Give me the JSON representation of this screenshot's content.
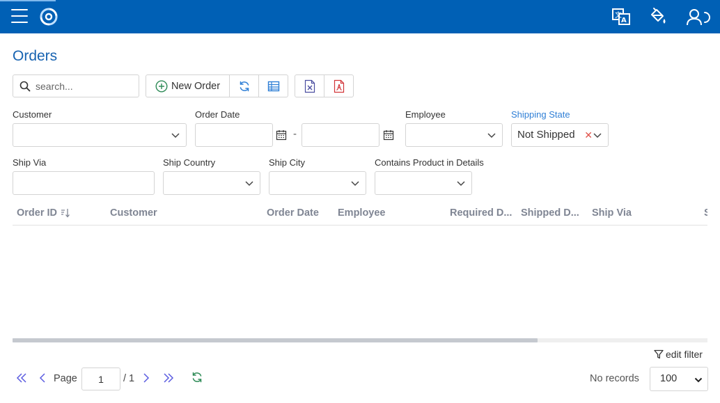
{
  "page": {
    "title": "Orders"
  },
  "toolbar": {
    "search_placeholder": "search...",
    "new_order_label": "New Order"
  },
  "filters": {
    "customer": {
      "label": "Customer",
      "value": ""
    },
    "order_date": {
      "label": "Order Date",
      "from": "",
      "to": "",
      "separator": "-"
    },
    "employee": {
      "label": "Employee",
      "value": ""
    },
    "shipping_state": {
      "label": "Shipping State",
      "value": "Not Shipped"
    },
    "ship_via": {
      "label": "Ship Via",
      "value": ""
    },
    "ship_country": {
      "label": "Ship Country",
      "value": ""
    },
    "ship_city": {
      "label": "Ship City",
      "value": ""
    },
    "contains_product": {
      "label": "Contains Product in Details",
      "value": ""
    }
  },
  "grid": {
    "columns": [
      "Order ID",
      "Customer",
      "Order Date",
      "Employee",
      "Required D...",
      "Shipped D...",
      "Ship Via",
      "S"
    ],
    "rows": []
  },
  "footer": {
    "edit_filter_label": "edit filter",
    "page_label": "Page",
    "current_page": "1",
    "total_pages_label": "/ 1",
    "status": "No records",
    "page_size": "100"
  },
  "colors": {
    "header_bg": "#0060b5",
    "title": "#1763b1",
    "accent_blue": "#2f7fd6",
    "green": "#2e8b57",
    "excel": "#4a4ea0",
    "pdf": "#d13438",
    "pager": "#5b5ce0"
  },
  "icons": {
    "header": [
      "menu-icon",
      "logo-icon",
      "translate-icon",
      "theme-icon",
      "user-icon"
    ],
    "toolbar": [
      "search-icon",
      "add-icon",
      "refresh-icon",
      "column-picker-icon",
      "excel-icon",
      "pdf-icon"
    ]
  }
}
